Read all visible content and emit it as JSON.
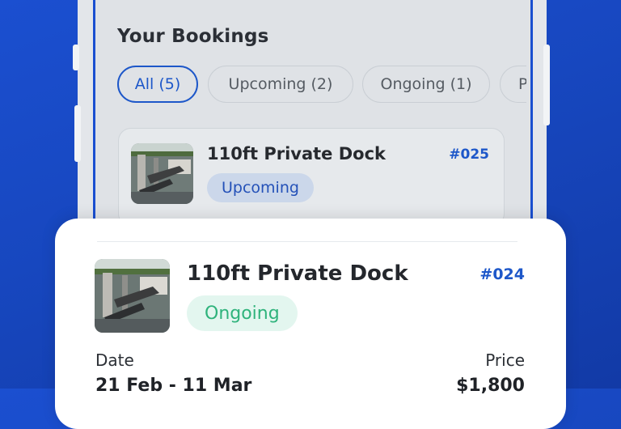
{
  "bookings": {
    "title": "Your Bookings",
    "tabs": [
      {
        "label": "All (5)"
      },
      {
        "label": "Upcoming (2)"
      },
      {
        "label": "Ongoing (1)"
      },
      {
        "label": "P"
      }
    ],
    "items": [
      {
        "name": "110ft Private Dock",
        "id": "#025",
        "status": "Upcoming"
      },
      {
        "name": "110ft Private Dock",
        "id": "#024",
        "status": "Ongoing",
        "date_label": "Date",
        "date_value": "21 Feb - 11 Mar",
        "price_label": "Price",
        "price_value": "$1,800"
      }
    ]
  },
  "colors": {
    "accent": "#1d57c9",
    "background": "#1747bf",
    "ongoing": "#2fb37c",
    "upcoming_bg": "#cbd7ea"
  }
}
